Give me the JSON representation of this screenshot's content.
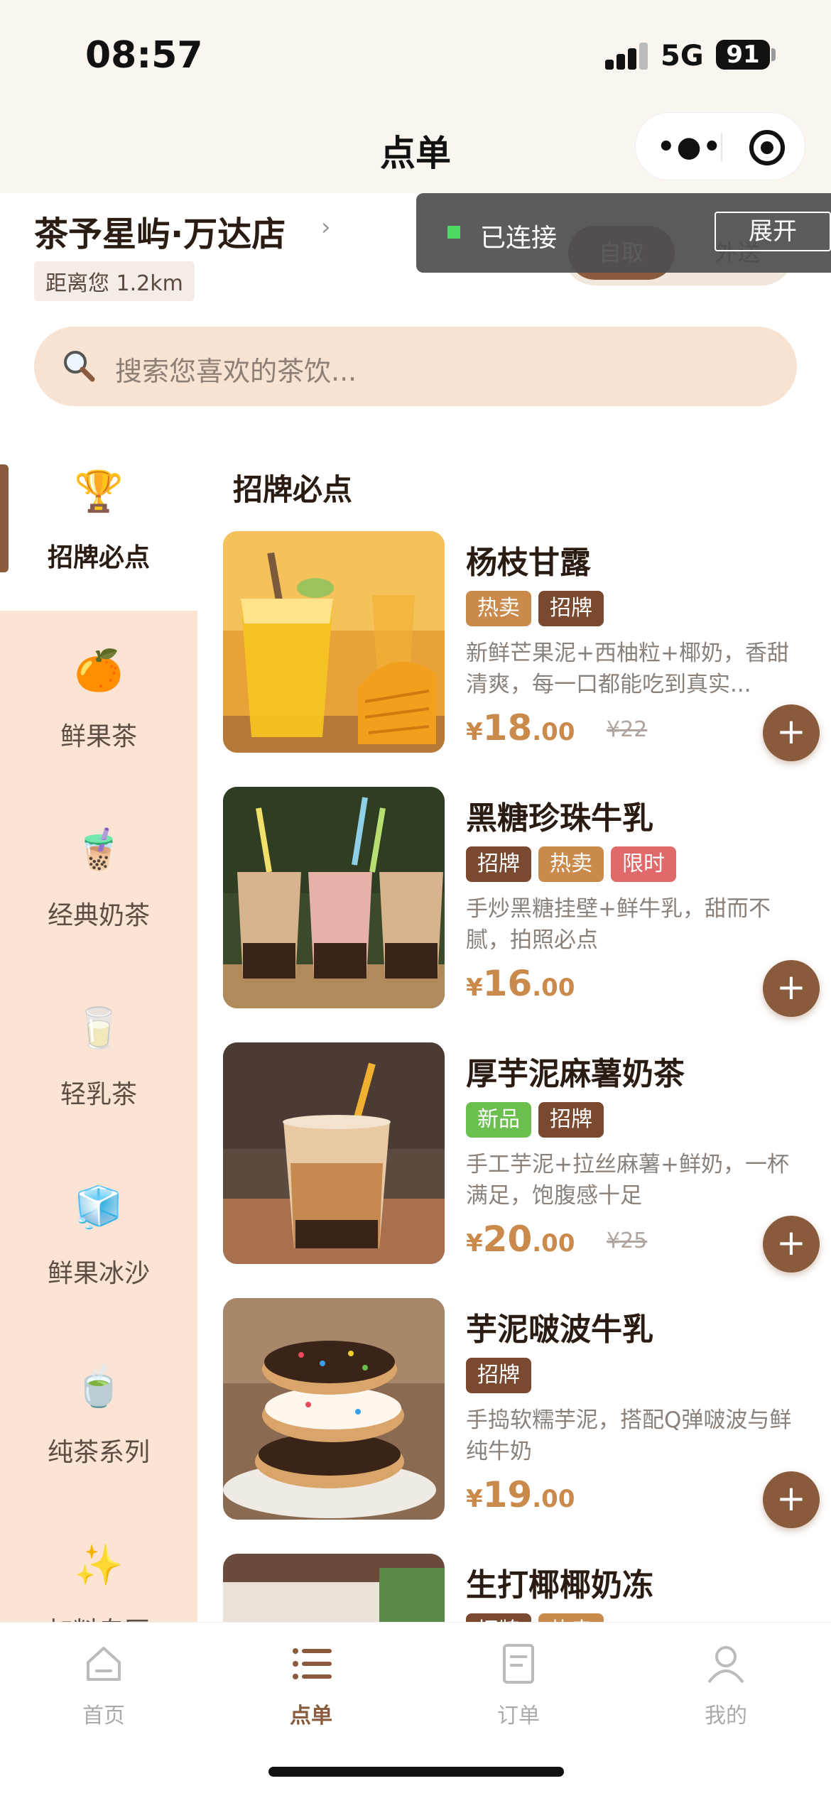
{
  "status_bar": {
    "time": "08:57",
    "network": "5G",
    "battery": "91"
  },
  "nav": {
    "title": "点单"
  },
  "store": {
    "name": "茶予星屿·万达店",
    "arrow": "›",
    "distance": "距离您 1.2km",
    "mode_pickup": "自取",
    "mode_delivery": "外送"
  },
  "search": {
    "placeholder": "搜索您喜欢的茶饮..."
  },
  "connection": {
    "status": "已连接",
    "expand_label": "展开"
  },
  "sidebar": {
    "items": [
      {
        "emoji": "🏆",
        "label": "招牌必点"
      },
      {
        "emoji": "🍊",
        "label": "鲜果茶"
      },
      {
        "emoji": "🧋",
        "label": "经典奶茶"
      },
      {
        "emoji": "🥛",
        "label": "轻乳茶"
      },
      {
        "emoji": "🧊",
        "label": "鲜果冰沙"
      },
      {
        "emoji": "🍵",
        "label": "纯茶系列"
      },
      {
        "emoji": "✨",
        "label": "加料专区"
      }
    ]
  },
  "content": {
    "section_title": "招牌必点",
    "products": [
      {
        "name": "杨枝甘露",
        "tags": [
          {
            "label": "热卖",
            "color": "#c98a4b"
          },
          {
            "label": "招牌",
            "color": "#7a4a30"
          }
        ],
        "desc": "新鲜芒果泥+西柚粒+椰奶，香甜清爽，每一口都能吃到真实...",
        "currency": "¥",
        "price_int": "18",
        "price_dec": ".00",
        "orig_price": "¥22"
      },
      {
        "name": "黑糖珍珠牛乳",
        "tags": [
          {
            "label": "招牌",
            "color": "#7a4a30"
          },
          {
            "label": "热卖",
            "color": "#c98a4b"
          },
          {
            "label": "限时",
            "color": "#e06a6a"
          }
        ],
        "desc": "手炒黑糖挂壁+鲜牛乳，甜而不腻，拍照必点",
        "currency": "¥",
        "price_int": "16",
        "price_dec": ".00",
        "orig_price": ""
      },
      {
        "name": "厚芋泥麻薯奶茶",
        "tags": [
          {
            "label": "新品",
            "color": "#6bbf4e"
          },
          {
            "label": "招牌",
            "color": "#7a4a30"
          }
        ],
        "desc": "手工芋泥+拉丝麻薯+鲜奶，一杯满足，饱腹感十足",
        "currency": "¥",
        "price_int": "20",
        "price_dec": ".00",
        "orig_price": "¥25"
      },
      {
        "name": "芋泥啵波牛乳",
        "tags": [
          {
            "label": "招牌",
            "color": "#7a4a30"
          }
        ],
        "desc": "手捣软糯芋泥，搭配Q弹啵波与鲜纯牛奶",
        "currency": "¥",
        "price_int": "19",
        "price_dec": ".00",
        "orig_price": ""
      },
      {
        "name": "生打椰椰奶冻",
        "tags": [
          {
            "label": "招牌",
            "color": "#7a4a30"
          },
          {
            "label": "热卖",
            "color": "#c98a4b"
          }
        ],
        "desc": "",
        "currency": "",
        "price_int": "",
        "price_dec": "",
        "orig_price": ""
      }
    ]
  },
  "tabbar": {
    "items": [
      {
        "label": "首页",
        "icon": "home-icon"
      },
      {
        "label": "点单",
        "icon": "list-icon"
      },
      {
        "label": "订单",
        "icon": "order-icon"
      },
      {
        "label": "我的",
        "icon": "profile-icon"
      }
    ]
  }
}
